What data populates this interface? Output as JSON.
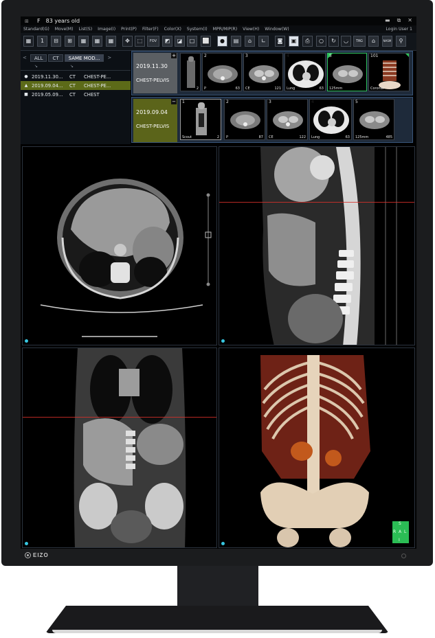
{
  "app": {
    "title_icon": "patient-icon",
    "sex": "F",
    "age": "83 years old",
    "login": "Login User 1"
  },
  "menu": [
    "Standard(G)",
    "Move(M)",
    "List(S)",
    "Image(I)",
    "Print(P)",
    "Filter(F)",
    "Color(X)",
    "System(I)",
    "MPR/MIP(R)",
    "View(H)",
    "Window(W)"
  ],
  "toolbar": {
    "btn1": "1",
    "btn4": "4",
    "fov": "FOV",
    "tag": "TAG",
    "nasm": "NASM"
  },
  "study_panel": {
    "tabs": [
      "ALL",
      "CT",
      "SAME MOD..."
    ],
    "studies": [
      {
        "marker": "●",
        "date": "2019.11.30...",
        "modality": "CT",
        "desc": "CHEST-PE..."
      },
      {
        "marker": "▲",
        "date": "2019.09.04...",
        "modality": "CT",
        "desc": "CHEST-PE..."
      },
      {
        "marker": "■",
        "date": "2019.05.09...",
        "modality": "CT",
        "desc": "CHEST"
      }
    ]
  },
  "series_rows": [
    {
      "date": "2019.11.30",
      "desc": "CHEST-PELVIS",
      "toggle": "+",
      "thumbs": [
        {
          "n": "",
          "c": "2",
          "l": ""
        },
        {
          "n": "2",
          "c": "63",
          "l": "P"
        },
        {
          "n": "3",
          "c": "121",
          "l": "CE"
        },
        {
          "n": "4",
          "c": "63",
          "l": "Lung"
        },
        {
          "n": "5",
          "c": "",
          "l": "125mm"
        },
        {
          "n": "101",
          "c": "",
          "l": "Coronal"
        }
      ]
    },
    {
      "date": "2019.09.04",
      "desc": "CHEST-PELVIS",
      "toggle": "−",
      "thumbs": [
        {
          "n": "1",
          "c": "2",
          "l": "Scout"
        },
        {
          "n": "2",
          "c": "87",
          "l": "P"
        },
        {
          "n": "3",
          "c": "122",
          "l": "CE"
        },
        {
          "n": "4",
          "c": "63",
          "l": "Lung"
        },
        {
          "n": "5",
          "c": "485",
          "l": "125mm"
        }
      ]
    }
  ],
  "orientation_marker": {
    "top": "S",
    "left": "R",
    "center": "A",
    "right": "L",
    "bottom": "I"
  },
  "colors": {
    "selected_row": "#5c6a18",
    "accent_cyan": "#37c6e0",
    "reference_line": "#d8302a",
    "orientation_box": "#2bbd55"
  }
}
